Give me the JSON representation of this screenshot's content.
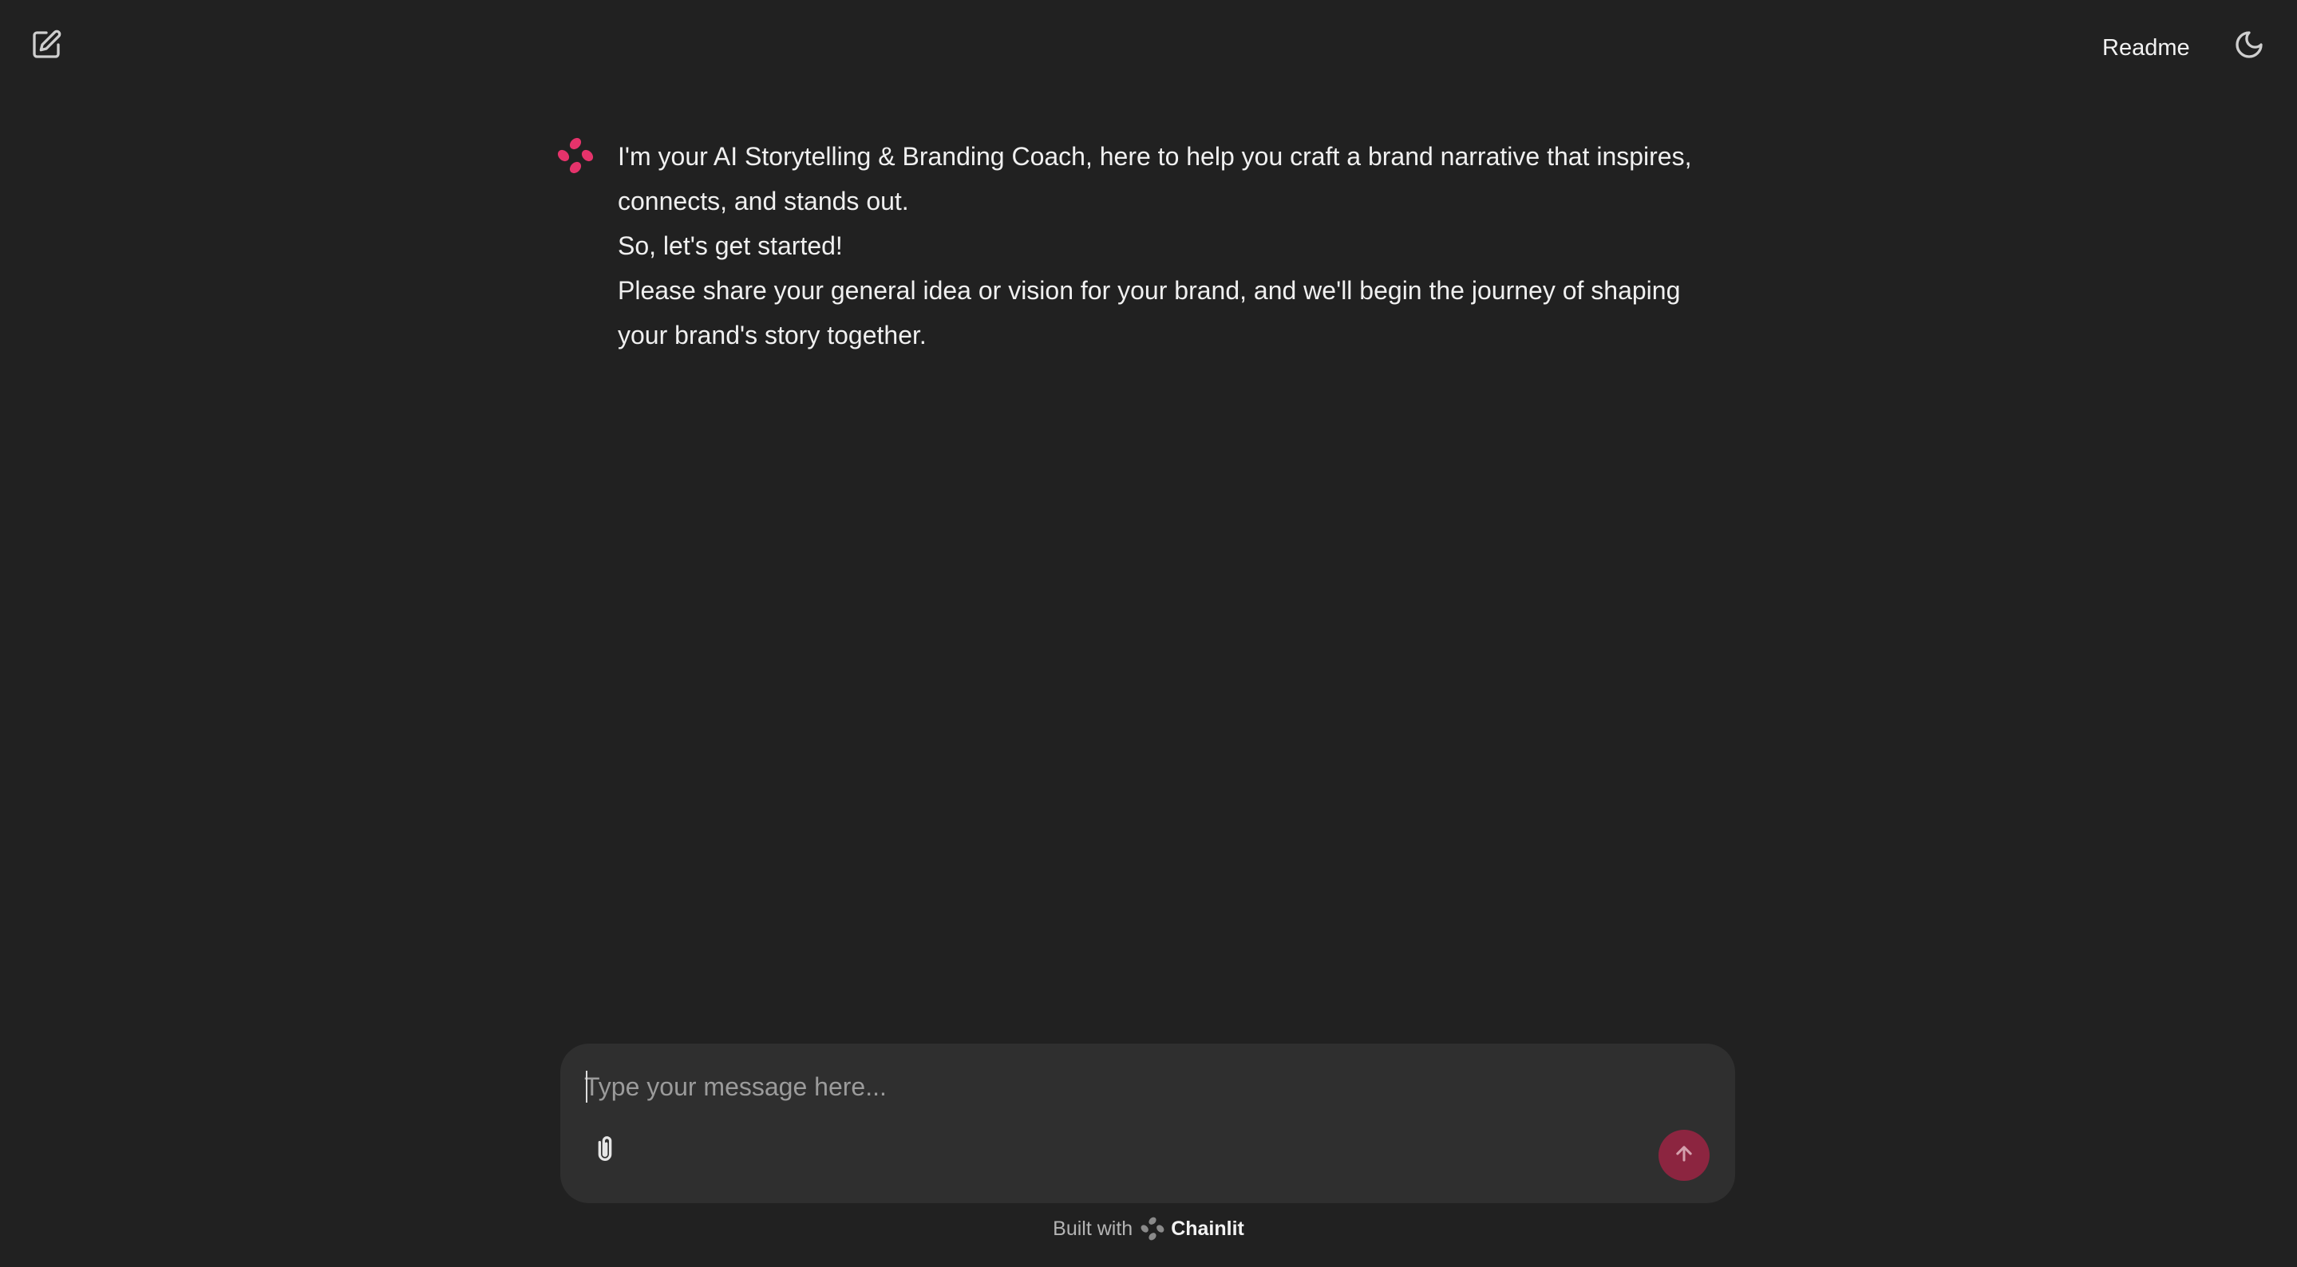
{
  "header": {
    "new_chat_icon": "edit-square-icon",
    "readme_label": "Readme",
    "theme_icon": "moon-icon"
  },
  "message": {
    "avatar_icon": "chainlit-logo-icon",
    "avatar_color": "#e5336b",
    "lines": [
      "I'm your AI Storytelling & Branding Coach, here to help you craft a brand narrative that inspires, connects, and stands out.",
      "So, let's get started!",
      "Please share your general idea or vision for your brand, and we'll begin the journey of shaping your brand's story together."
    ]
  },
  "composer": {
    "placeholder": "Type your message here...",
    "value": "",
    "attach_icon": "paperclip-icon",
    "send_icon": "arrow-up-icon",
    "send_color": "#8c2540"
  },
  "footer": {
    "built_with": "Built with",
    "brand": "Chainlit"
  }
}
